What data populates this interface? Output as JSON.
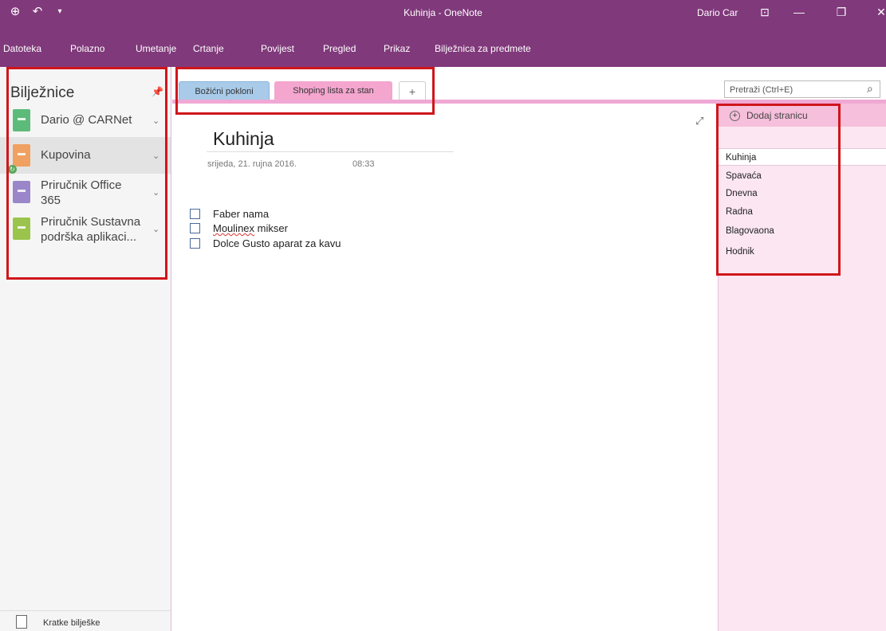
{
  "window": {
    "title": "Kuhinja - OneNote",
    "user": "Dario Car",
    "qat": {
      "back_icon": "back-circle-icon",
      "undo_icon": "undo-icon",
      "customize_icon": "dropdown-arrow-icon"
    },
    "controls": {
      "restore_ribbon_icon": "ribbon-display-icon",
      "minimize": "—",
      "maximize": "❐",
      "close": "✕"
    }
  },
  "ribbon": {
    "tabs": [
      "Datoteka",
      "Polazno",
      "Umetanje",
      "Crtanje",
      "Povijest",
      "Pregled",
      "Prikaz",
      "Bilježnica za predmete"
    ]
  },
  "notebooks": {
    "header": "Bilježnice",
    "pin_icon": "pin-icon",
    "items": [
      {
        "label": "Dario @ CARNet",
        "color": "#5dbb7a"
      },
      {
        "label": "Kupovina",
        "color": "#f0a060"
      },
      {
        "label": "Priručnik Office 365",
        "color": "#9a86c8"
      },
      {
        "label": "Priručnik Sustavna podrška aplikaci...",
        "color": "#9ac44c"
      }
    ],
    "quick_notes": "Kratke bilješke"
  },
  "sections": {
    "tabs": [
      "Božićni pokloni",
      "Shoping lista za stan"
    ],
    "add_label": "+"
  },
  "search": {
    "placeholder": "Pretraži (Ctrl+E)"
  },
  "page": {
    "title": "Kuhinja",
    "date": "srijeda, 21. rujna 2016.",
    "time": "08:33",
    "todos": [
      {
        "pre": "",
        "sq": "",
        "post": "Faber nama",
        "checked": false
      },
      {
        "pre": "",
        "sq": "Moulinex",
        "post": " mikser",
        "checked": false
      },
      {
        "pre": "",
        "sq": "",
        "post": "Dolce Gusto aparat za kavu",
        "checked": false
      }
    ]
  },
  "pagelist": {
    "add_label": "Dodaj stranicu",
    "items": [
      "Kuhinja",
      "Spavaća",
      "Dnevna",
      "Radna",
      "Blagovaona",
      "Hodnik"
    ]
  },
  "colors": {
    "accent": "#80397b",
    "section_pink": "#f4a6cf",
    "section_blue": "#a9cbe9",
    "highlight": "#d0161b"
  }
}
